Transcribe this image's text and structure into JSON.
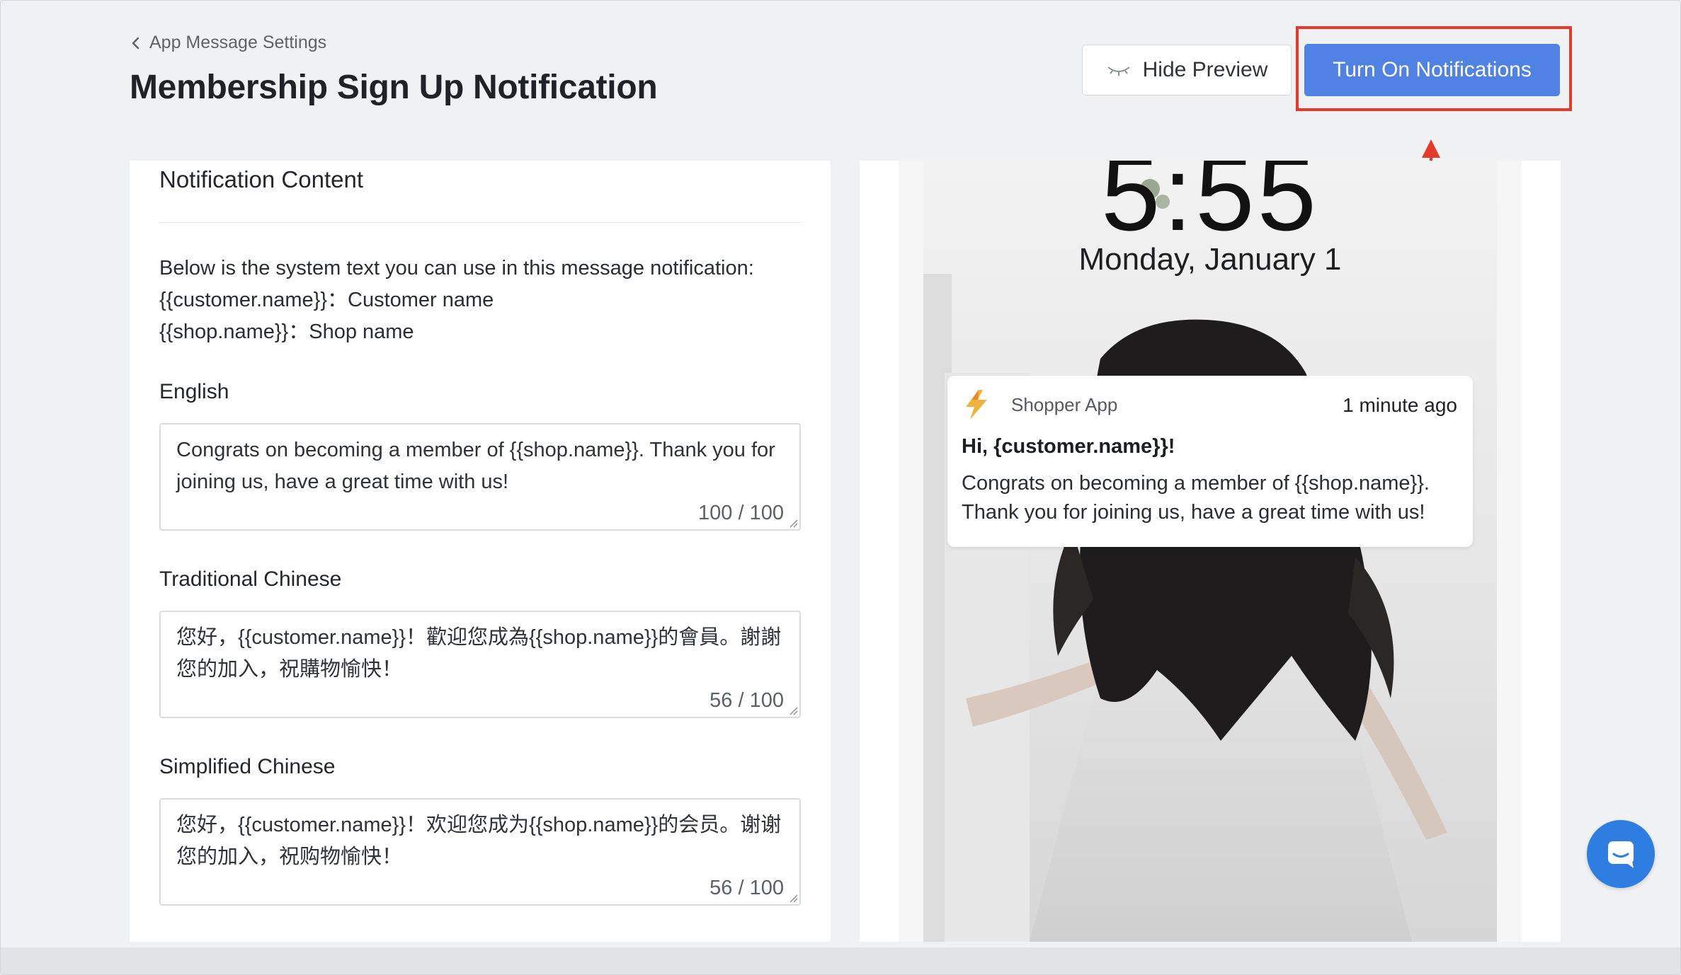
{
  "header": {
    "breadcrumb": "App Message Settings",
    "title": "Membership Sign Up Notification",
    "hide_preview_label": "Hide Preview",
    "turn_on_label": "Turn On Notifications"
  },
  "content": {
    "card_title": "Notification Content",
    "system_text_intro": "Below is the system text you can use in this message notification:",
    "system_variables": [
      "{{customer.name}}：Customer name",
      "{{shop.name}}：Shop name"
    ],
    "fields": [
      {
        "label": "English",
        "value": "Congrats on becoming a member of {{shop.name}}. Thank you for joining us, have a great time with us!",
        "count": "100 / 100"
      },
      {
        "label": "Traditional Chinese",
        "value": "您好，{{customer.name}}！歡迎您成為{{shop.name}}的會員。謝謝您的加入，祝購物愉快！",
        "count": "56 / 100"
      },
      {
        "label": "Simplified Chinese",
        "value": "您好，{{customer.name}}！欢迎您成为{{shop.name}}的会员。谢谢您的加入，祝购物愉快！",
        "count": "56 / 100"
      }
    ]
  },
  "preview": {
    "clock": "5:55",
    "date": "Monday, January 1",
    "notification": {
      "app_name": "Shopper App",
      "time": "1 minute ago",
      "title": "Hi, {customer.name}}!",
      "body": "Congrats on becoming a member of {{shop.name}}. Thank you for joining us, have a great time with us!"
    }
  },
  "colors": {
    "primary": "#4f82e3",
    "highlight": "#e53a2a",
    "chat": "#2e7de0",
    "background": "#f0f1f3"
  },
  "icons": {
    "breadcrumb": "chevron-left-icon",
    "hide_preview": "eye-closed-icon",
    "app_logo": "lightning-logo-icon",
    "chat": "chat-bubble-icon"
  }
}
